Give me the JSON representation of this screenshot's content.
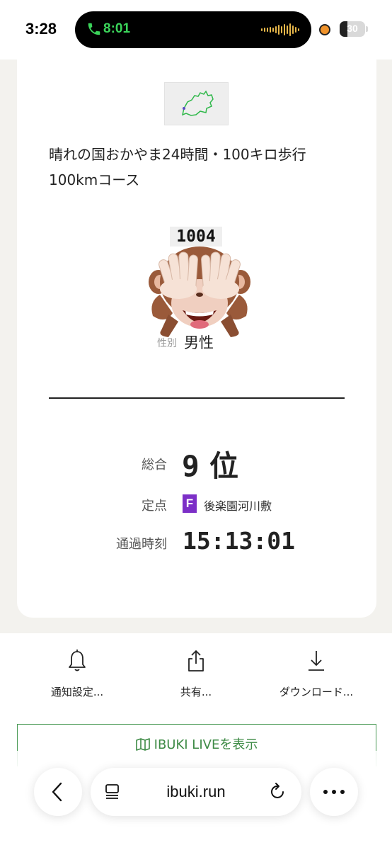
{
  "status_bar": {
    "time": "3:28",
    "call_time": "8:01",
    "battery": "30",
    "battery_level": 0.3
  },
  "runner": {
    "event_title": "晴れの国おかやま24時間・100キロ歩行 100kmコース",
    "bib": "1004",
    "gender_label": "性別",
    "gender": "男性"
  },
  "result": {
    "rank_label": "総合",
    "rank_number": "9",
    "rank_suffix": "位",
    "checkpoint_label": "定点",
    "checkpoint_code": "F",
    "checkpoint_name": "後楽園河川敷",
    "time_label": "通過時刻",
    "time": "15:13:01",
    "colors": {
      "checkpoint_badge": "#7c2fc7",
      "live_accent": "#3d8a45"
    }
  },
  "actions": {
    "notify_label": "通知設定...",
    "share_label": "共有...",
    "download_label": "ダウンロード...",
    "live_label": "IBUKI LIVEを表示",
    "icons": [
      "bell-icon",
      "share-icon",
      "download-icon",
      "map-icon"
    ]
  },
  "browser": {
    "url": "ibuki.run"
  }
}
